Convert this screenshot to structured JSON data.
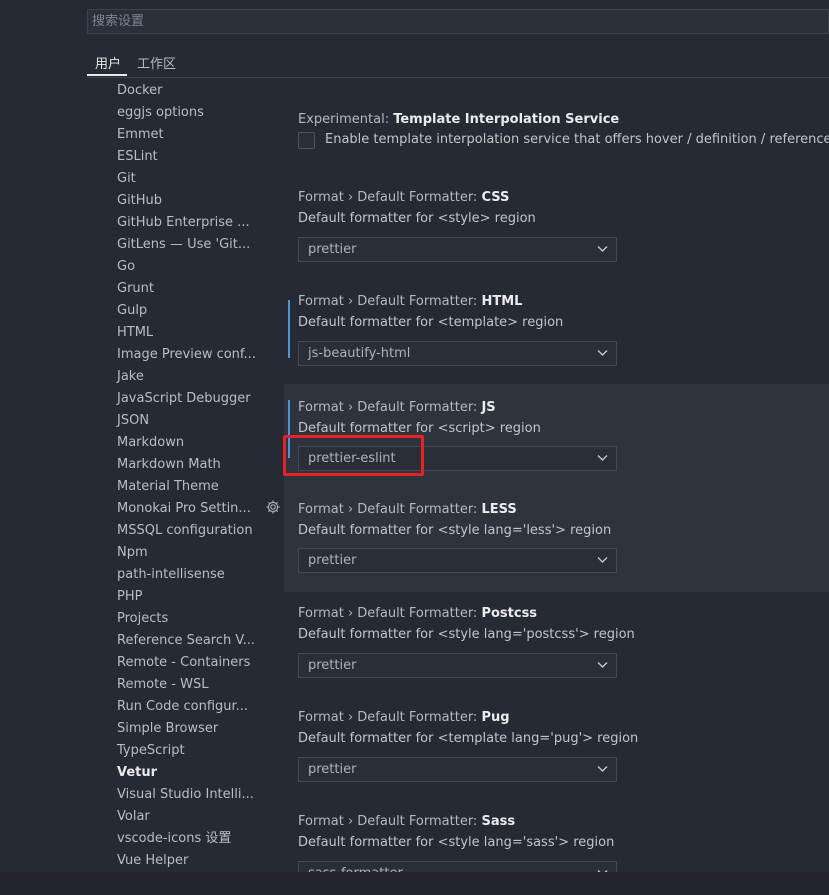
{
  "search": {
    "placeholder": "搜索设置"
  },
  "tabs": [
    {
      "label": "用户",
      "active": true
    },
    {
      "label": "工作区",
      "active": false
    }
  ],
  "toc": {
    "items": [
      {
        "label": "Docker"
      },
      {
        "label": "eggjs options"
      },
      {
        "label": "Emmet"
      },
      {
        "label": "ESLint"
      },
      {
        "label": "Git"
      },
      {
        "label": "GitHub"
      },
      {
        "label": "GitHub Enterprise ..."
      },
      {
        "label": "GitLens — Use 'Git..."
      },
      {
        "label": "Go"
      },
      {
        "label": "Grunt"
      },
      {
        "label": "Gulp"
      },
      {
        "label": "HTML"
      },
      {
        "label": "Image Preview conf..."
      },
      {
        "label": "Jake"
      },
      {
        "label": "JavaScript Debugger"
      },
      {
        "label": "JSON"
      },
      {
        "label": "Markdown"
      },
      {
        "label": "Markdown Math"
      },
      {
        "label": "Material Theme"
      },
      {
        "label": "Monokai Pro Settin..."
      },
      {
        "label": "MSSQL configuration"
      },
      {
        "label": "Npm"
      },
      {
        "label": "path-intellisense"
      },
      {
        "label": "PHP"
      },
      {
        "label": "Projects"
      },
      {
        "label": "Reference Search V..."
      },
      {
        "label": "Remote - Containers"
      },
      {
        "label": "Remote - WSL"
      },
      {
        "label": "Run Code configur..."
      },
      {
        "label": "Simple Browser"
      },
      {
        "label": "TypeScript"
      },
      {
        "label": "Vetur",
        "selected": true
      },
      {
        "label": "Visual Studio Intelli..."
      },
      {
        "label": "Volar"
      },
      {
        "label": "vscode-icons 设置"
      },
      {
        "label": "Vue Helper"
      }
    ]
  },
  "settings": [
    {
      "category": "Experimental: ",
      "name": "Template Interpolation Service",
      "checkbox_label": "Enable template interpolation service that offers hover / definition / references in Vue interpolations.",
      "checked": false
    },
    {
      "category": "Format › Default Formatter: ",
      "name": "CSS",
      "description": "Default formatter for <style> region",
      "value": "prettier"
    },
    {
      "category": "Format › Default Formatter: ",
      "name": "HTML",
      "description": "Default formatter for <template> region",
      "value": "js-beautify-html",
      "modified": true
    },
    {
      "category": "Format › Default Formatter: ",
      "name": "JS",
      "description": "Default formatter for <script> region",
      "value": "prettier-eslint",
      "modified": true,
      "focused": true
    },
    {
      "category": "Format › Default Formatter: ",
      "name": "LESS",
      "description": "Default formatter for <style lang='less'> region",
      "value": "prettier",
      "hovered": true
    },
    {
      "category": "Format › Default Formatter: ",
      "name": "Postcss",
      "description": "Default formatter for <style lang='postcss'> region",
      "value": "prettier"
    },
    {
      "category": "Format › Default Formatter: ",
      "name": "Pug",
      "description": "Default formatter for <template lang='pug'> region",
      "value": "prettier"
    },
    {
      "category": "Format › Default Formatter: ",
      "name": "Sass",
      "description": "Default formatter for <style lang='sass'> region",
      "value": "sass-formatter"
    }
  ],
  "icons": {
    "gear": "gear-icon",
    "chevron": "chevron-down-icon"
  },
  "colors": {
    "background": "#262a33",
    "highlight_row": "#2f333c",
    "modified_bar": "#4f95d6",
    "annotation_box": "#e52129"
  }
}
